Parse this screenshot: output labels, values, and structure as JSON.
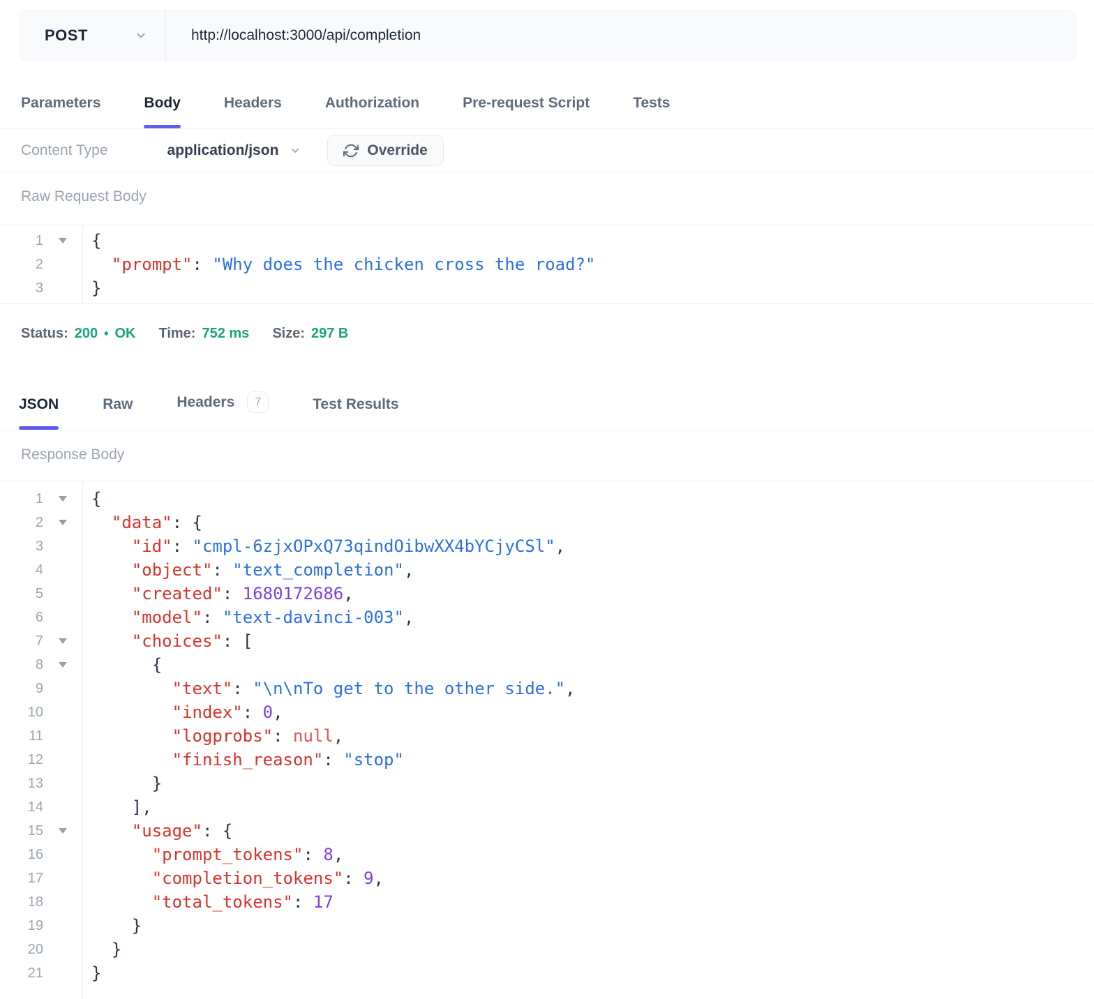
{
  "request_bar": {
    "method": "POST",
    "url": "http://localhost:3000/api/completion"
  },
  "request_tabs": {
    "active": "Body",
    "items": [
      "Parameters",
      "Body",
      "Headers",
      "Authorization",
      "Pre-request Script",
      "Tests"
    ]
  },
  "content_type": {
    "label": "Content Type",
    "value": "application/json",
    "override_label": "Override"
  },
  "request_body": {
    "label": "Raw Request Body",
    "lines": [
      {
        "num": 1,
        "fold": true,
        "tokens": [
          [
            "p",
            "{"
          ]
        ]
      },
      {
        "num": 2,
        "fold": false,
        "tokens": [
          [
            "p",
            "  "
          ],
          [
            "k",
            "\"prompt\""
          ],
          [
            "p",
            ": "
          ],
          [
            "s",
            "\"Why does the chicken cross the road?\""
          ]
        ]
      },
      {
        "num": 3,
        "fold": false,
        "tokens": [
          [
            "p",
            "}"
          ]
        ]
      }
    ]
  },
  "status_bar": {
    "status_label": "Status:",
    "status_code": "200",
    "status_sep": "•",
    "status_text": "OK",
    "time_label": "Time:",
    "time_value": "752 ms",
    "size_label": "Size:",
    "size_value": "297 B"
  },
  "response_tabs": {
    "active": "JSON",
    "items": [
      "JSON",
      "Raw",
      "Headers",
      "Test Results"
    ],
    "headers_badge": "7"
  },
  "response_body": {
    "label": "Response Body",
    "lines": [
      {
        "num": 1,
        "fold": true,
        "tokens": [
          [
            "p",
            "{"
          ]
        ]
      },
      {
        "num": 2,
        "fold": true,
        "tokens": [
          [
            "p",
            "  "
          ],
          [
            "k",
            "\"data\""
          ],
          [
            "p",
            ": {"
          ]
        ]
      },
      {
        "num": 3,
        "fold": false,
        "tokens": [
          [
            "p",
            "    "
          ],
          [
            "k",
            "\"id\""
          ],
          [
            "p",
            ": "
          ],
          [
            "s",
            "\"cmpl-6zjxOPxQ73qindOibwXX4bYCjyCSl\""
          ],
          [
            "p",
            ","
          ]
        ]
      },
      {
        "num": 4,
        "fold": false,
        "tokens": [
          [
            "p",
            "    "
          ],
          [
            "k",
            "\"object\""
          ],
          [
            "p",
            ": "
          ],
          [
            "s",
            "\"text_completion\""
          ],
          [
            "p",
            ","
          ]
        ]
      },
      {
        "num": 5,
        "fold": false,
        "tokens": [
          [
            "p",
            "    "
          ],
          [
            "k",
            "\"created\""
          ],
          [
            "p",
            ": "
          ],
          [
            "n",
            "1680172686"
          ],
          [
            "p",
            ","
          ]
        ]
      },
      {
        "num": 6,
        "fold": false,
        "tokens": [
          [
            "p",
            "    "
          ],
          [
            "k",
            "\"model\""
          ],
          [
            "p",
            ": "
          ],
          [
            "s",
            "\"text-davinci-003\""
          ],
          [
            "p",
            ","
          ]
        ]
      },
      {
        "num": 7,
        "fold": true,
        "tokens": [
          [
            "p",
            "    "
          ],
          [
            "k",
            "\"choices\""
          ],
          [
            "p",
            ": ["
          ]
        ]
      },
      {
        "num": 8,
        "fold": true,
        "tokens": [
          [
            "p",
            "      {"
          ]
        ]
      },
      {
        "num": 9,
        "fold": false,
        "tokens": [
          [
            "p",
            "        "
          ],
          [
            "k",
            "\"text\""
          ],
          [
            "p",
            ": "
          ],
          [
            "s",
            "\"\\n\\nTo get to the other side.\""
          ],
          [
            "p",
            ","
          ]
        ]
      },
      {
        "num": 10,
        "fold": false,
        "tokens": [
          [
            "p",
            "        "
          ],
          [
            "k",
            "\"index\""
          ],
          [
            "p",
            ": "
          ],
          [
            "n",
            "0"
          ],
          [
            "p",
            ","
          ]
        ]
      },
      {
        "num": 11,
        "fold": false,
        "tokens": [
          [
            "p",
            "        "
          ],
          [
            "k",
            "\"logprobs\""
          ],
          [
            "p",
            ": "
          ],
          [
            "u",
            "null"
          ],
          [
            "p",
            ","
          ]
        ]
      },
      {
        "num": 12,
        "fold": false,
        "tokens": [
          [
            "p",
            "        "
          ],
          [
            "k",
            "\"finish_reason\""
          ],
          [
            "p",
            ": "
          ],
          [
            "s",
            "\"stop\""
          ]
        ]
      },
      {
        "num": 13,
        "fold": false,
        "tokens": [
          [
            "p",
            "      }"
          ]
        ]
      },
      {
        "num": 14,
        "fold": false,
        "tokens": [
          [
            "p",
            "    ],"
          ]
        ]
      },
      {
        "num": 15,
        "fold": true,
        "tokens": [
          [
            "p",
            "    "
          ],
          [
            "k",
            "\"usage\""
          ],
          [
            "p",
            ": {"
          ]
        ]
      },
      {
        "num": 16,
        "fold": false,
        "tokens": [
          [
            "p",
            "      "
          ],
          [
            "k",
            "\"prompt_tokens\""
          ],
          [
            "p",
            ": "
          ],
          [
            "n",
            "8"
          ],
          [
            "p",
            ","
          ]
        ]
      },
      {
        "num": 17,
        "fold": false,
        "tokens": [
          [
            "p",
            "      "
          ],
          [
            "k",
            "\"completion_tokens\""
          ],
          [
            "p",
            ": "
          ],
          [
            "n",
            "9"
          ],
          [
            "p",
            ","
          ]
        ]
      },
      {
        "num": 18,
        "fold": false,
        "tokens": [
          [
            "p",
            "      "
          ],
          [
            "k",
            "\"total_tokens\""
          ],
          [
            "p",
            ": "
          ],
          [
            "n",
            "17"
          ]
        ]
      },
      {
        "num": 19,
        "fold": false,
        "tokens": [
          [
            "p",
            "    }"
          ]
        ]
      },
      {
        "num": 20,
        "fold": false,
        "tokens": [
          [
            "p",
            "  }"
          ]
        ]
      },
      {
        "num": 21,
        "fold": false,
        "tokens": [
          [
            "p",
            "}"
          ]
        ]
      }
    ]
  },
  "colors": {
    "accent": "#5e5bef",
    "success": "#16a57a",
    "json_key": "#d93229",
    "json_string": "#2b6fe4",
    "json_number": "#7c3fe4",
    "json_null": "#e25555"
  }
}
